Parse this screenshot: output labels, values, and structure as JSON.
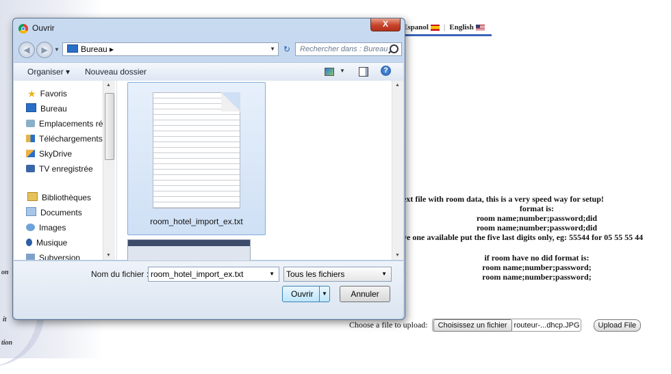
{
  "page": {
    "languages": [
      {
        "label": "Espanol",
        "flag": "es-flag-icon"
      },
      {
        "label": "English",
        "flag": "us-flag-icon"
      }
    ],
    "info_lines": [
      "ext file with room data, this is a very speed way for setup!",
      "format is:",
      "room name;number;password;did",
      "room name;number;password;did",
      "ve one available put the five last digits only, eg: 55544 for 05 55 55 44",
      "if room have no did format is:",
      "room name;number;password;",
      "room name;number;password;"
    ],
    "upload": {
      "label": "Choose a file to upload:",
      "choose_button": "Choisissez un fichier",
      "file_name": "routeur-...dhcp.JPG",
      "upload_button": "Upload File"
    },
    "left_fragments": [
      "on",
      "it",
      "tion"
    ]
  },
  "dialog": {
    "title": "Ouvrir",
    "close_label": "X",
    "address": "Bureau ▸",
    "search_placeholder": "Rechercher dans : Bureau",
    "toolbar": {
      "organize": "Organiser ▾",
      "new_folder": "Nouveau dossier",
      "help": "?"
    },
    "nav_items": [
      {
        "label": "Favoris",
        "icon": "star-icon"
      },
      {
        "label": "Bureau",
        "icon": "desktop-icon"
      },
      {
        "label": "Emplacements ré",
        "icon": "recent-places-icon"
      },
      {
        "label": "Téléchargements",
        "icon": "downloads-icon"
      },
      {
        "label": "SkyDrive",
        "icon": "skydrive-icon"
      },
      {
        "label": "TV enregistrée",
        "icon": "tv-icon"
      },
      {
        "label": "Bibliothèques",
        "icon": "libraries-icon"
      },
      {
        "label": "Documents",
        "icon": "documents-icon"
      },
      {
        "label": "Images",
        "icon": "images-icon"
      },
      {
        "label": "Musique",
        "icon": "music-icon"
      },
      {
        "label": "Subversion",
        "icon": "subversion-icon"
      }
    ],
    "selected_file": "room_hotel_import_ex.txt",
    "file_name_label": "Nom du fichier :",
    "file_name_value": "room_hotel_import_ex.txt",
    "filter": "Tous les fichiers",
    "open_button": "Ouvrir",
    "cancel_button": "Annuler"
  }
}
